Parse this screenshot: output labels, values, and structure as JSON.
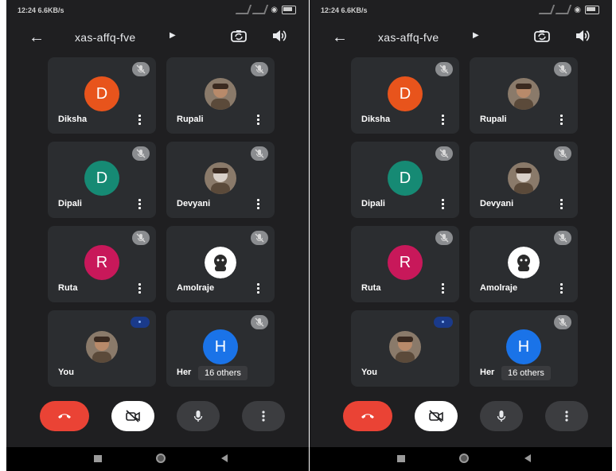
{
  "screens": [
    {
      "status": {
        "time": "12:24 6.6KB/s"
      },
      "meeting_code": "xas-affq-fve",
      "participants": [
        {
          "name": "Diksha",
          "initial": "D",
          "color": "#e8541c"
        },
        {
          "name": "Rupali"
        },
        {
          "name": "Dipali",
          "initial": "D",
          "color": "#168a74"
        },
        {
          "name": "Devyani"
        },
        {
          "name": "Ruta",
          "initial": "R",
          "color": "#c8185a"
        },
        {
          "name": "Amolraje"
        },
        {
          "name": "You"
        },
        {
          "name": "Her",
          "initial": "H",
          "color": "#1a73e8",
          "others_label": "16 others"
        }
      ]
    },
    {
      "status": {
        "time": "12:24 6.6KB/s"
      },
      "meeting_code": "xas-affq-fve",
      "participants": [
        {
          "name": "Diksha",
          "initial": "D",
          "color": "#e8541c"
        },
        {
          "name": "Rupali"
        },
        {
          "name": "Dipali",
          "initial": "D",
          "color": "#168a74"
        },
        {
          "name": "Devyani"
        },
        {
          "name": "Ruta",
          "initial": "R",
          "color": "#c8185a"
        },
        {
          "name": "Amolraje"
        },
        {
          "name": "You"
        },
        {
          "name": "Her",
          "initial": "H",
          "color": "#1a73e8",
          "others_label": "16 others"
        }
      ]
    }
  ],
  "icons": {
    "back": "arrow-left-icon",
    "camera_flip": "camera-flip-icon",
    "speaker": "speaker-icon",
    "muted": "mic-off-icon",
    "end_call": "phone-hangup-icon",
    "camera_off": "camera-off-icon",
    "mic": "mic-icon",
    "more": "more-vert-icon"
  },
  "colors": {
    "background": "#1f1f21",
    "tile": "#2b2d30",
    "end_call": "#ea4335",
    "speaking": "#1a3a8a"
  }
}
